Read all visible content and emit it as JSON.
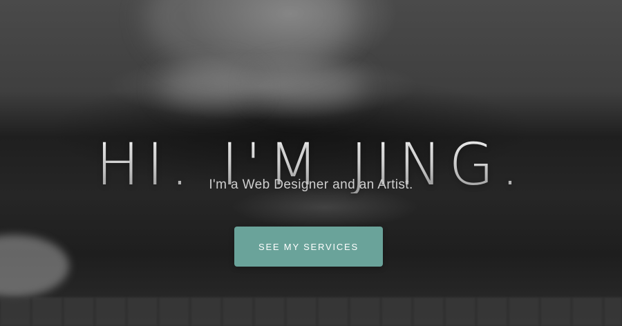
{
  "hero": {
    "headline": "HI. I'M JING.",
    "subtitle": "I'm a Web Designer and an Artist.",
    "cta_label": "SEE MY SERVICES",
    "cta_color": "#6aa39a",
    "background_tone": "#2a2a2a"
  }
}
